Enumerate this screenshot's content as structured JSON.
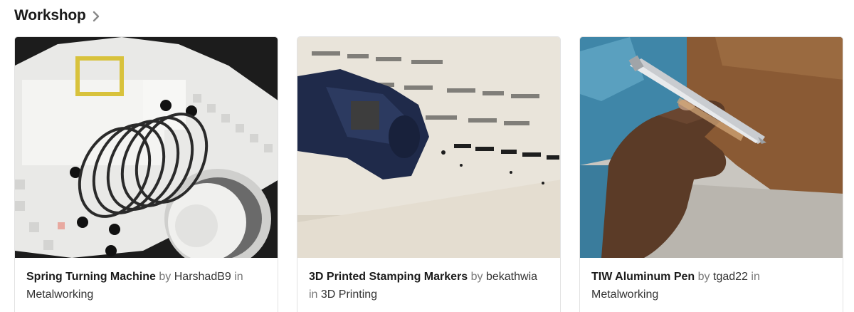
{
  "section": {
    "title": "Workshop",
    "chevron_icon": "chevron-right-icon"
  },
  "cards": [
    {
      "title": "Spring Turning Machine",
      "by_label": "by",
      "author": "HarshadB9",
      "in_label": "in",
      "category": "Metalworking",
      "image": "photo of white 3D-printed machine with metal spring"
    },
    {
      "title": "3D Printed Stamping Markers",
      "by_label": "by",
      "author": "bekathwia",
      "in_label": "in",
      "category": "3D Printing",
      "image": "photo of navy marker stamping BECKY onto paper"
    },
    {
      "title": "TIW Aluminum Pen",
      "by_label": "by",
      "author": "tgad22",
      "in_label": "in",
      "category": "Metalworking",
      "image": "photo of hand holding an aluminum pen"
    }
  ],
  "colors": {
    "title_text": "#1a1a1a",
    "meta_text": "#777777",
    "card_border": "#e2e2e2",
    "chevron": "#888888"
  }
}
